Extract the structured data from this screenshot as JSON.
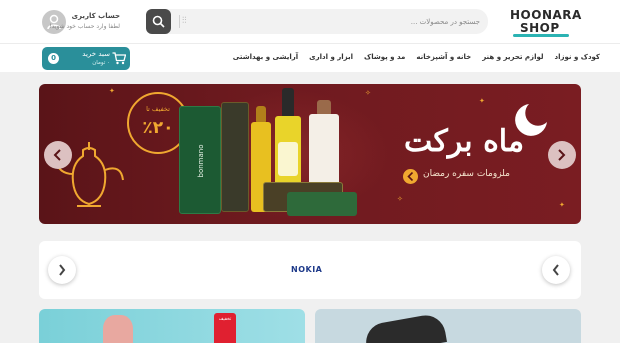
{
  "header": {
    "logo_line1": "HOONARA",
    "logo_line2": "SHOP",
    "search_placeholder": "جستجو در محصولات ...",
    "account_title": "حساب کاربری",
    "account_subtitle": "لطفا وارد حساب خود شوید!"
  },
  "nav": {
    "items": [
      "آرایشی و بهداشتی",
      "ابزار و اداری",
      "مد و پوشاک",
      "خانه و آشپزخانه",
      "لوازم تحریر و هنر",
      "کودک و نوزاد"
    ],
    "cart_title": "سبد خرید",
    "cart_total": "۰ تومان",
    "cart_count": "0"
  },
  "banner": {
    "title": "ماه برکت",
    "subtitle": "ملزومات سفره رمضان",
    "discount_label": "تخفیف تا",
    "discount_value": "٪۲۰",
    "product_label": "bonmano",
    "colors": {
      "background": "#6e1a1f",
      "accent": "#f0a830"
    }
  },
  "brands": {
    "visible_brand": "NOKIA"
  },
  "tiles": {
    "left_badge": "تخفیف"
  },
  "icons": {
    "search": "search-icon",
    "mic": "mic-icon",
    "user": "user-icon",
    "cart": "cart-icon",
    "prev": "chevron-left-icon",
    "next": "chevron-right-icon"
  }
}
